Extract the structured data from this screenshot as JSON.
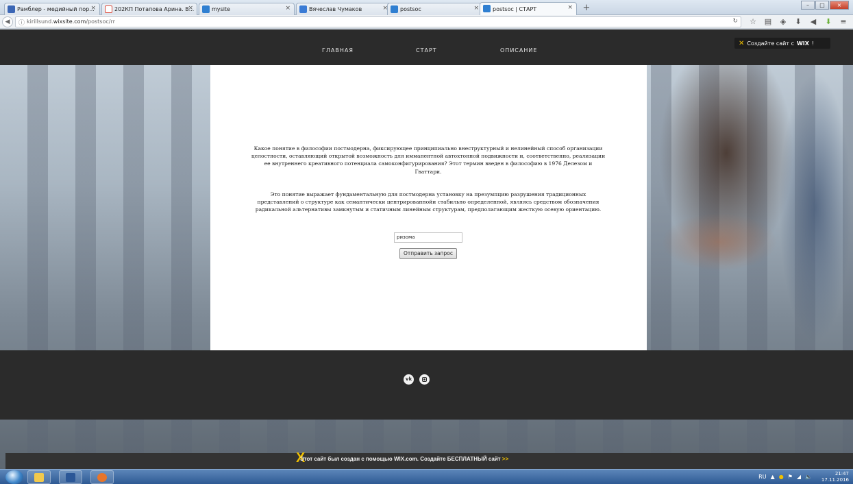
{
  "browser": {
    "tabs": [
      {
        "label": "Рамблер - медийный пор...",
        "favicon_color": "#3b66b5"
      },
      {
        "label": "202КП Потапова Арина. В...",
        "favicon_color": "#d94a3a"
      },
      {
        "label": "mysite",
        "favicon_color": "#2f7fd1"
      },
      {
        "label": "Вячеслав Чумаков",
        "favicon_color": "#3a7bd5"
      },
      {
        "label": "postsoc",
        "favicon_color": "#2f7fd1"
      },
      {
        "label": "postsoc | СТАРТ",
        "favicon_color": "#2f7fd1"
      }
    ],
    "newtab_label": "+",
    "url_prefix": "kirillsund.",
    "url_host": "wixsite.com",
    "url_path": "/postsoc/rr",
    "window_buttons": [
      "–",
      "□",
      "×"
    ]
  },
  "site": {
    "menu": [
      "ГЛАВНАЯ",
      "СТАРТ",
      "ОПИСАНИЕ"
    ],
    "wix_badge": {
      "text": "Создайте сайт с",
      "brand": "WIX",
      "suffix": "!"
    },
    "question": "Какое понятие в философии постмодерна, фиксирующее принципиально внеструктурный и нелинейный способ организации целостности, оставляющий открытой возможность для имманентной автохтонной подвижности и, соответственно, реализации ее внутреннего креативного потенциала самоконфигурирования? Этот термин введен в философию в 1976 Делезом и Гваттари.",
    "hint": "Это понятие выражает фундаментальную для постмодерна установку на презумпцию разрушения традиционных представлений о структуре как семантически центрированнойи стабильно определенной, являясь средством обозначения радикальной альтернативы замкнутым и статичным линейным структурам, предполагающим жесткую осевую ориентацию.",
    "answer_value": "ризома",
    "submit_label": "Отправить запрос",
    "social": [
      {
        "name": "vk",
        "glyph": "vk"
      },
      {
        "name": "instagram",
        "glyph": ""
      }
    ],
    "wix_bar": {
      "text": "Этот сайт был создан с помощью WIX.com. Создайте БЕСПЛАТНЫЙ сайт",
      "arrow": ">>"
    }
  },
  "taskbar": {
    "apps": [
      {
        "name": "explorer",
        "color": "#f2c94c"
      },
      {
        "name": "word",
        "color": "#2b5797"
      },
      {
        "name": "firefox",
        "color": "#e8752a"
      }
    ],
    "tray": [
      "RU",
      "▲",
      "●",
      "⚑",
      "◢",
      "🔈"
    ],
    "time": "21:47",
    "date": "17.11.2016"
  }
}
